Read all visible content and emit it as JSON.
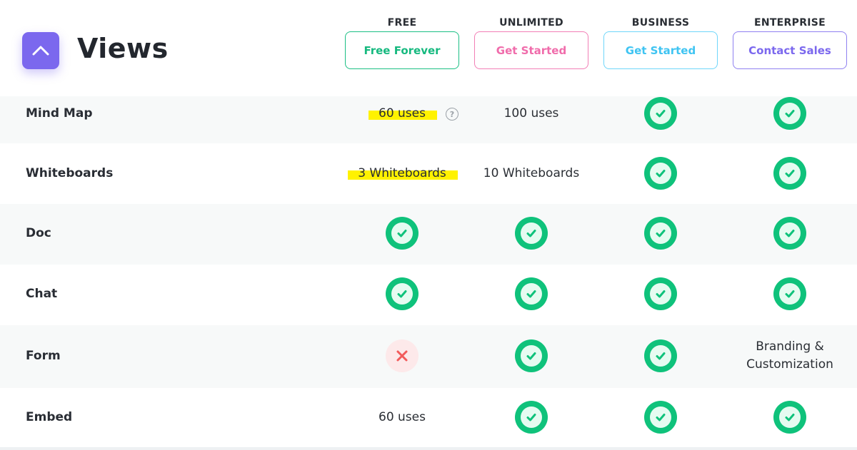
{
  "section": {
    "title": "Views"
  },
  "plans": [
    {
      "name": "FREE",
      "cta": "Free Forever",
      "color": "#1bbf84"
    },
    {
      "name": "UNLIMITED",
      "cta": "Get Started",
      "color": "#f06cab"
    },
    {
      "name": "BUSINESS",
      "cta": "Get Started",
      "color": "#49ccf9"
    },
    {
      "name": "ENTERPRISE",
      "cta": "Contact Sales",
      "color": "#7b68ee"
    }
  ],
  "rows": [
    {
      "feature": "Mind Map",
      "cells": [
        {
          "type": "text",
          "value": "60 uses",
          "highlight": true,
          "help_icon": "question-icon"
        },
        {
          "type": "text",
          "value": "100 uses"
        },
        {
          "type": "check"
        },
        {
          "type": "check"
        }
      ]
    },
    {
      "feature": "Whiteboards",
      "cells": [
        {
          "type": "text",
          "value": "3 Whiteboards",
          "highlight": true
        },
        {
          "type": "text",
          "value": "10 Whiteboards"
        },
        {
          "type": "check"
        },
        {
          "type": "check"
        }
      ]
    },
    {
      "feature": "Doc",
      "cells": [
        {
          "type": "check"
        },
        {
          "type": "check"
        },
        {
          "type": "check"
        },
        {
          "type": "check"
        }
      ]
    },
    {
      "feature": "Chat",
      "cells": [
        {
          "type": "check"
        },
        {
          "type": "check"
        },
        {
          "type": "check"
        },
        {
          "type": "check"
        }
      ]
    },
    {
      "feature": "Form",
      "cells": [
        {
          "type": "cross"
        },
        {
          "type": "check"
        },
        {
          "type": "check"
        },
        {
          "type": "text",
          "value": "Branding & Customization"
        }
      ]
    },
    {
      "feature": "Embed",
      "cells": [
        {
          "type": "text",
          "value": "60 uses"
        },
        {
          "type": "check"
        },
        {
          "type": "check"
        },
        {
          "type": "check"
        }
      ]
    }
  ],
  "colors": {
    "accent": "#7b68ee",
    "check": "#0fc27b",
    "cross": "#f25a5a",
    "highlight": "#fff200",
    "shaded_row": "#f7f9f9"
  }
}
